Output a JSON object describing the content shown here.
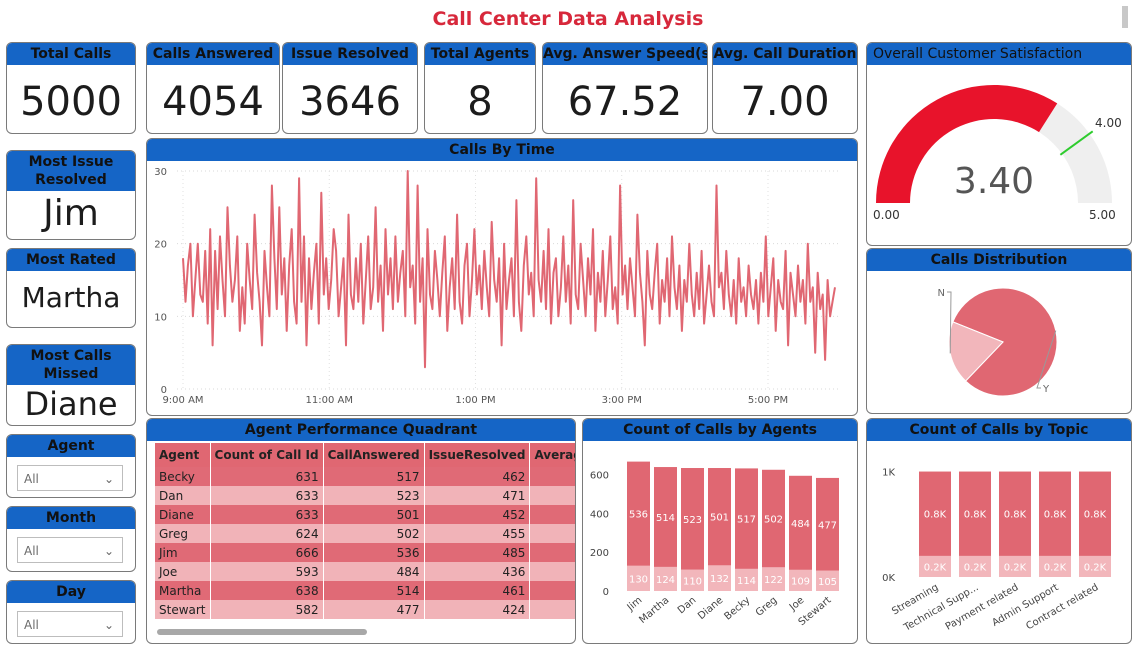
{
  "title": "Call Center Data Analysis",
  "kpis": {
    "total_calls": {
      "label": "Total Calls",
      "value": "5000"
    },
    "calls_answered": {
      "label": "Calls Answered",
      "value": "4054"
    },
    "issue_resolved": {
      "label": "Issue Resolved",
      "value": "3646"
    },
    "total_agents": {
      "label": "Total Agents",
      "value": "8"
    },
    "avg_answer_speed": {
      "label": "Avg. Answer Speed(s)",
      "value": "67.52"
    },
    "avg_call_duration": {
      "label": "Avg. Call Duration",
      "value": "7.00"
    }
  },
  "highlights": {
    "most_issue_resolved": {
      "label": "Most Issue Resolved",
      "value": "Jim"
    },
    "most_rated": {
      "label": "Most Rated",
      "value": "Martha"
    },
    "most_calls_missed": {
      "label": "Most Calls Missed",
      "value": "Diane"
    }
  },
  "slicers": [
    {
      "label": "Agent",
      "value": "All"
    },
    {
      "label": "Month",
      "value": "All"
    },
    {
      "label": "Day",
      "value": "All"
    }
  ],
  "gauge": {
    "title": "Overall Customer Satisfaction",
    "value": "3.40",
    "min": "0.00",
    "max": "5.00",
    "target": "4.00",
    "value_num": 3.4,
    "target_num": 4.0,
    "max_num": 5.0,
    "fill_color": "#e8132b",
    "track_color": "#efefef",
    "target_color": "#2ecc2e"
  },
  "colors": {
    "header": "#1565c6",
    "accent": "#d7283b",
    "bar_dark": "#e06772",
    "bar_light": "#f2b6bb"
  },
  "chart_data": [
    {
      "type": "line",
      "title": "Calls By Time",
      "x_ticks": [
        "9:00 AM",
        "11:00 AM",
        "1:00 PM",
        "3:00 PM",
        "5:00 PM"
      ],
      "y_ticks": [
        "0",
        "10",
        "20",
        "30"
      ],
      "ylim": [
        0,
        30
      ],
      "x_range": [
        "9:00 AM",
        "5:55 PM"
      ],
      "color": "#e06772",
      "values": [
        18,
        12,
        17,
        20,
        10,
        15,
        20,
        13,
        12,
        19,
        9,
        22,
        6,
        19,
        11,
        21,
        15,
        10,
        25,
        17,
        12,
        15,
        21,
        8,
        14,
        9,
        20,
        15,
        11,
        24,
        16,
        12,
        6,
        19,
        14,
        10,
        28,
        18,
        11,
        25,
        13,
        18,
        8,
        17,
        22,
        12,
        9,
        29,
        12,
        21,
        6,
        18,
        11,
        16,
        20,
        9,
        27,
        13,
        18,
        11,
        15,
        22,
        19,
        10,
        14,
        18,
        6,
        24,
        13,
        11,
        18,
        12,
        20,
        9,
        15,
        21,
        11,
        14,
        25,
        12,
        17,
        8,
        22,
        13,
        18,
        11,
        21,
        12,
        16,
        19,
        10,
        30,
        14,
        17,
        9,
        28,
        12,
        18,
        3,
        22,
        13,
        11,
        19,
        15,
        10,
        16,
        21,
        8,
        14,
        18,
        11,
        24,
        12,
        9,
        17,
        20,
        10,
        15,
        22,
        13,
        17,
        11,
        19,
        14,
        10,
        23,
        15,
        12,
        18,
        6,
        20,
        11,
        15,
        18,
        10,
        26,
        12,
        8,
        17,
        21,
        13,
        16,
        10,
        29,
        15,
        12,
        19,
        11,
        22,
        9,
        16,
        18,
        10,
        14,
        21,
        12,
        17,
        9,
        26,
        13,
        11,
        20,
        15,
        10,
        18,
        13,
        22,
        8,
        16,
        12,
        19,
        10,
        15,
        21,
        11,
        14,
        9,
        28,
        13,
        17,
        11,
        18,
        14,
        10,
        24,
        16,
        12,
        6,
        19,
        13,
        11,
        16,
        20,
        9,
        15,
        12,
        18,
        10,
        21,
        14,
        11,
        17,
        8,
        15,
        12,
        20,
        13,
        10,
        16,
        11,
        19,
        9,
        13,
        17,
        12,
        10,
        28,
        14,
        16,
        11,
        19,
        13,
        10,
        15,
        9,
        18,
        12,
        14,
        10,
        17,
        13,
        11,
        15,
        9,
        16,
        12,
        21,
        10,
        14,
        18,
        8,
        15,
        12,
        11,
        19,
        6,
        16,
        13,
        10,
        17,
        12,
        15,
        9,
        20,
        12,
        14,
        5,
        16,
        11,
        13,
        4,
        15,
        10,
        12,
        14
      ]
    },
    {
      "type": "table",
      "title": "Agent Performance Quadrant",
      "columns": [
        "Agent",
        "Count of Call Id",
        "CallAnswered",
        "IssueResolved",
        "Average of AvgC"
      ],
      "rows": [
        [
          "Becky",
          "631",
          "517",
          "462",
          ""
        ],
        [
          "Dan",
          "633",
          "523",
          "471",
          ""
        ],
        [
          "Diane",
          "633",
          "501",
          "452",
          ""
        ],
        [
          "Greg",
          "624",
          "502",
          "455",
          ""
        ],
        [
          "Jim",
          "666",
          "536",
          "485",
          ""
        ],
        [
          "Joe",
          "593",
          "484",
          "436",
          ""
        ],
        [
          "Martha",
          "638",
          "514",
          "461",
          ""
        ],
        [
          "Stewart",
          "582",
          "477",
          "424",
          ""
        ]
      ]
    },
    {
      "type": "bar",
      "stacked": true,
      "title": "Count of Calls by Agents",
      "categories": [
        "Jim",
        "Martha",
        "Dan",
        "Diane",
        "Becky",
        "Greg",
        "Joe",
        "Stewart"
      ],
      "series": [
        {
          "values": [
            130,
            124,
            110,
            132,
            114,
            122,
            109,
            105
          ]
        },
        {
          "values": [
            536,
            514,
            523,
            501,
            517,
            502,
            484,
            477
          ]
        }
      ],
      "y_ticks": [
        "0",
        "200",
        "400",
        "600"
      ],
      "ylim": [
        0,
        700
      ]
    },
    {
      "type": "pie",
      "title": "Calls Distribution",
      "labels": [
        "Y",
        "N"
      ],
      "values": [
        4054,
        946
      ]
    },
    {
      "type": "bar",
      "stacked": true,
      "title": "Count of Calls by Topic",
      "categories": [
        "Streaming",
        "Technical Supp...",
        "Payment related",
        "Admin Support",
        "Contract related"
      ],
      "series": [
        {
          "values": [
            200,
            200,
            200,
            200,
            200
          ],
          "labels": [
            "0.2K",
            "0.2K",
            "0.2K",
            "0.2K",
            "0.2K"
          ]
        },
        {
          "values": [
            800,
            800,
            800,
            800,
            800
          ],
          "labels": [
            "0.8K",
            "0.8K",
            "0.8K",
            "0.8K",
            "0.8K"
          ]
        }
      ],
      "y_ticks": [
        "0K",
        "1K"
      ],
      "ylim": [
        0,
        1100
      ]
    }
  ]
}
